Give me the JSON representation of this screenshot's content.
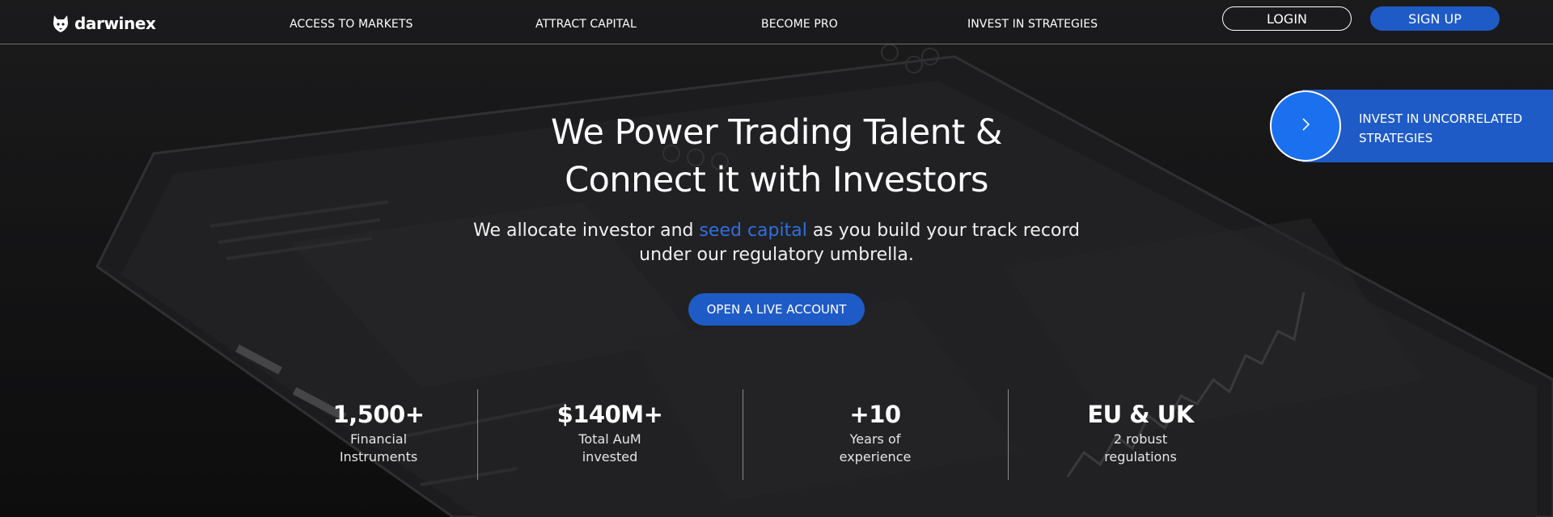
{
  "brand": {
    "name": "darwinex",
    "logo_icon": "wolf-head-icon"
  },
  "nav": {
    "links": [
      "ACCESS TO MARKETS",
      "ATTRACT CAPITAL",
      "BECOME PRO",
      "INVEST IN STRATEGIES"
    ],
    "login": "LOGIN",
    "signup": "SIGN UP"
  },
  "side_banner": {
    "icon": "chevron-right-icon",
    "text": "INVEST IN UNCORRELATED STRATEGIES"
  },
  "hero": {
    "title_line1": "We Power Trading Talent &",
    "title_line2": "Connect it with Investors",
    "sub_before": "We allocate investor and ",
    "sub_link": "seed capital",
    "sub_after": " as you build your track record",
    "sub_line2": "under our regulatory umbrella.",
    "cta": "OPEN A LIVE ACCOUNT"
  },
  "stats": [
    {
      "value": "1,500+",
      "label_line1": "Financial",
      "label_line2": "Instruments"
    },
    {
      "value": "$140M+",
      "label_line1": "Total AuM",
      "label_line2": "invested"
    },
    {
      "value": "+10",
      "label_line1": "Years of",
      "label_line2": "experience"
    },
    {
      "value": "EU & UK",
      "label_line1": "2 robust",
      "label_line2": "regulations"
    }
  ],
  "colors": {
    "accent": "#1f5bc7",
    "link": "#2f6fe0",
    "circle": "#1b70f0",
    "background": "#1c1c1e"
  }
}
